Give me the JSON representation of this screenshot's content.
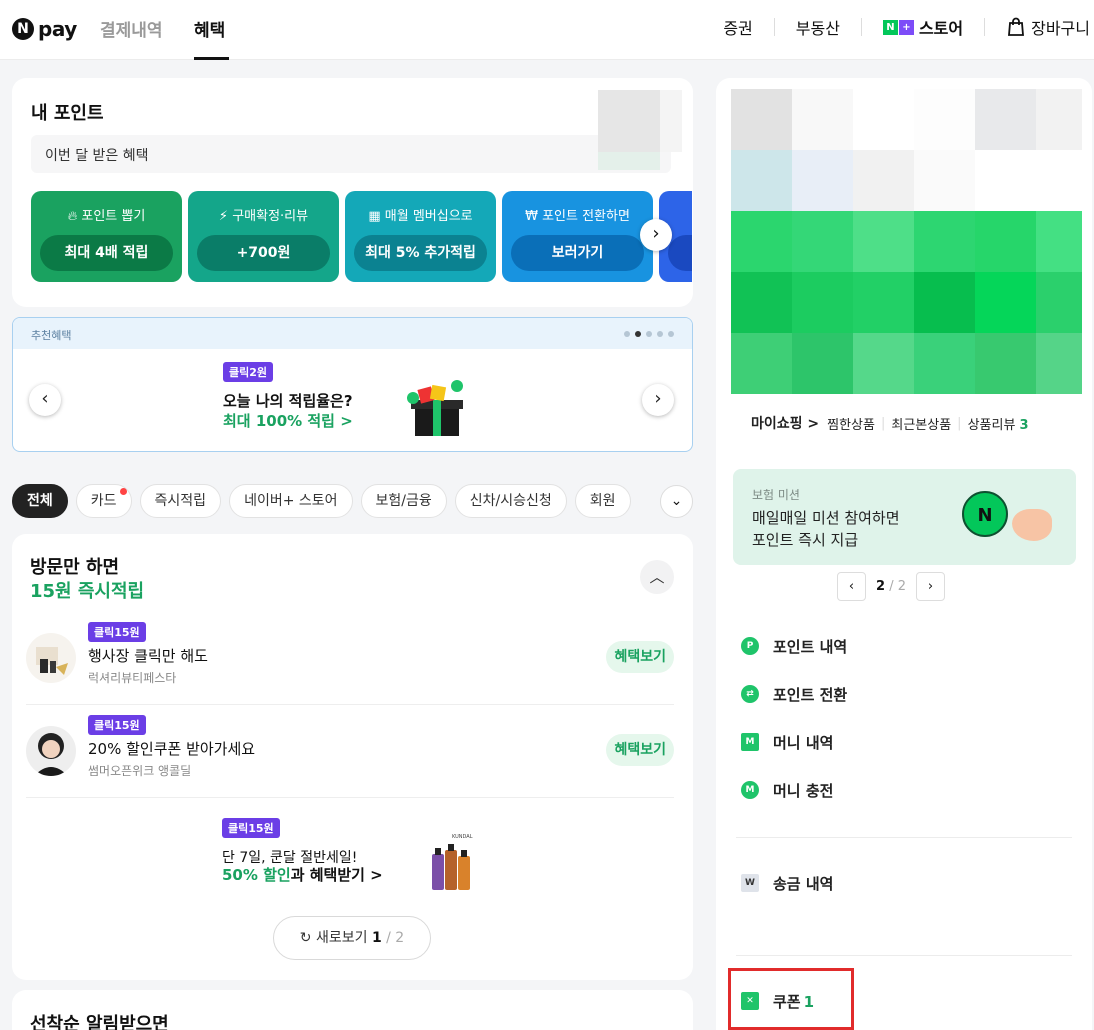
{
  "header": {
    "logo_text": "pay",
    "tabs": [
      {
        "label": "결제내역",
        "active": false
      },
      {
        "label": "혜택",
        "active": true
      }
    ],
    "right_links": [
      {
        "label": "증권"
      },
      {
        "label": "부동산"
      },
      {
        "label": "스토어"
      },
      {
        "label": "장바구니"
      }
    ]
  },
  "points": {
    "title": "내 포인트",
    "benefit_text": "이번 달 받은 혜택",
    "tiles": [
      {
        "title": "포인트 뽑기",
        "button": "최대 4배 적립",
        "icon": "flame-icon"
      },
      {
        "title": "구매확정·리뷰",
        "button": "+700원",
        "icon": "lightning-icon"
      },
      {
        "title": "매월 멤버십으로",
        "button": "최대 5% 추가적립",
        "icon": "membership-icon"
      },
      {
        "title": "포인트 전환하면",
        "button": "보러가기",
        "icon": "won-icon"
      }
    ]
  },
  "recommend": {
    "header": "추천혜택",
    "badge": "클릭2원",
    "line1": "오늘 나의 적립율은?",
    "line2": "최대 100% 적립 >"
  },
  "filters": {
    "chips": [
      "전체",
      "카드",
      "즉시적립",
      "네이버+ 스토어",
      "보험/금융",
      "신차/시승신청",
      "회원"
    ]
  },
  "visit": {
    "title1": "방문만 하면",
    "title2": "15원 즉시적립",
    "items": [
      {
        "badge": "클릭15원",
        "title": "행사장 클릭만 해도",
        "sub": "럭셔리뷰티페스타",
        "button": "혜택보기"
      },
      {
        "badge": "클릭15원",
        "title": "20% 할인쿠폰 받아가세요",
        "sub": "썸머오픈위크 앵콜딜",
        "button": "혜택보기"
      }
    ],
    "promo": {
      "badge": "클릭15원",
      "line1": "단 7일, 쿤달 절반세일!",
      "line2_green": "50% 할인",
      "line2_rest": "과 혜택받기 >",
      "product_brand": "KUNDAL"
    },
    "refresh": {
      "label": "새로보기",
      "current": "1",
      "total": "/ 2"
    }
  },
  "next_section": {
    "title": "선착순 알림받으면"
  },
  "sidebar": {
    "myshop": {
      "head": "마이쇼핑 >",
      "links": [
        "찜한상품",
        "최근본상품"
      ],
      "review_label": "상품리뷰",
      "review_count": "3"
    },
    "mission": {
      "label": "보험 미션",
      "line1": "매일매일 미션 참여하면",
      "line2": "포인트 즉시 지급"
    },
    "pager": {
      "current": "2",
      "total": "/ 2"
    },
    "menu": [
      {
        "label": "포인트 내역",
        "icon": "point-icon"
      },
      {
        "label": "포인트 전환",
        "icon": "exchange-icon"
      },
      {
        "label": "머니 내역",
        "icon": "money-receipt-icon"
      },
      {
        "label": "머니 충전",
        "icon": "money-charge-icon"
      },
      {
        "label": "송금 내역",
        "icon": "transfer-icon"
      }
    ],
    "coupon": {
      "label": "쿠폰",
      "count": "1"
    }
  },
  "colors": {
    "brand_green": "#03c75a",
    "text_green": "#1aa260",
    "badge_purple": "#6b3ee6",
    "highlight_red": "#e12b2b"
  }
}
